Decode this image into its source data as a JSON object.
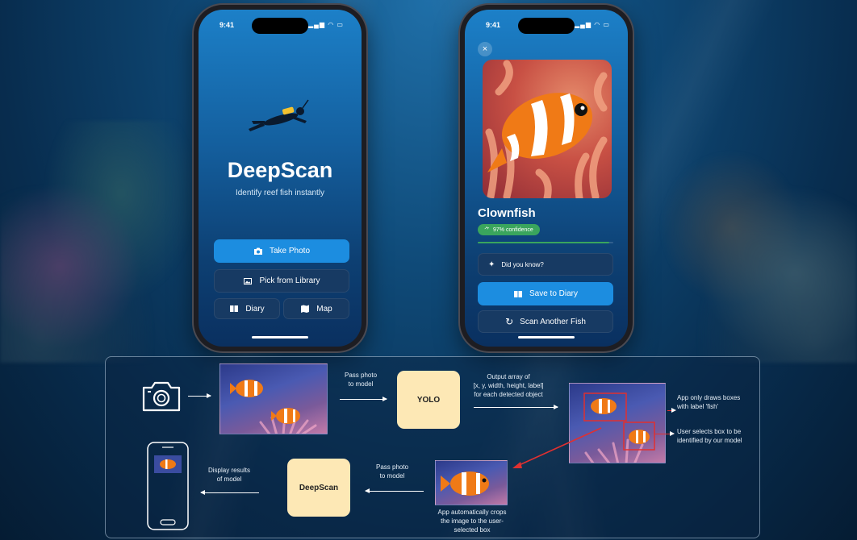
{
  "phone_home": {
    "time": "9:41",
    "app_name": "DeepScan",
    "tagline": "Identify reef fish instantly",
    "take_photo": "Take Photo",
    "pick_library": "Pick from Library",
    "diary": "Diary",
    "map": "Map"
  },
  "phone_result": {
    "time": "9:41",
    "close": "×",
    "species": "Clownfish",
    "confidence": "97% confidence",
    "confidence_value": 0.97,
    "did_you_know": "Did you know?",
    "save_diary": "Save to Diary",
    "scan_another": "Scan Another Fish"
  },
  "pipeline": {
    "pass_photo_1": "Pass photo\nto model",
    "yolo": "YOLO",
    "output_array": "Output array of\n[x, y, width, height, label]\nfor each detected object",
    "draws_boxes": "App only draws boxes\nwith label 'fish'",
    "user_selects": "User selects box to be\nidentified by our model",
    "crops": "App automatically crops\nthe image to the user-\nselected box",
    "pass_photo_2": "Pass photo\nto model",
    "deepscan": "DeepScan",
    "display_results": "Display results\nof model"
  },
  "colors": {
    "primary_button": "#1c8de0",
    "confidence_green": "#3aa55d",
    "model_box": "#fde8b5",
    "detect_box": "#e03030"
  }
}
